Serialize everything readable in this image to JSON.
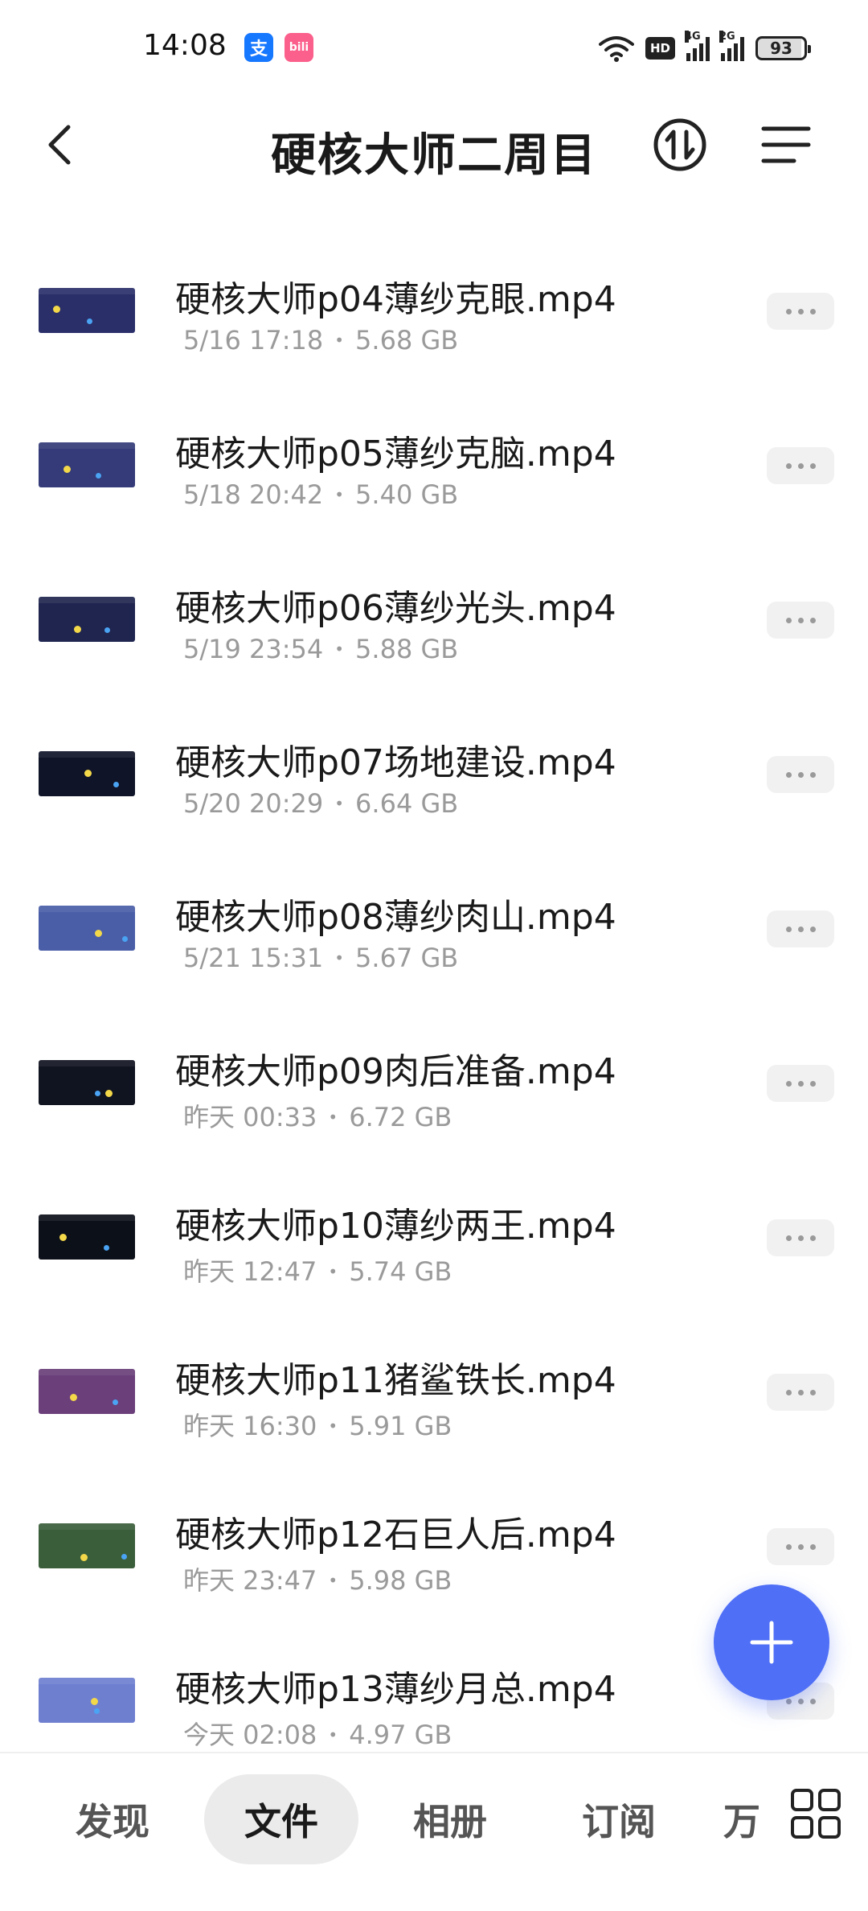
{
  "status_bar": {
    "time": "14:08",
    "app_badge_1": "支",
    "app_badge_2": "bili",
    "hd_label": "HD",
    "signal_1_label": "4G",
    "signal_2_label": "2G",
    "battery_level": "93"
  },
  "header": {
    "title": "硬核大师二周目"
  },
  "files": [
    {
      "name": "硬核大师p04薄纱克眼.mp4",
      "date": "5/16 17:18",
      "size": "5.68 GB",
      "thumb_color": "#2a2f6a"
    },
    {
      "name": "硬核大师p05薄纱克脑.mp4",
      "date": "5/18 20:42",
      "size": "5.40 GB",
      "thumb_color": "#343b78"
    },
    {
      "name": "硬核大师p06薄纱光头.mp4",
      "date": "5/19 23:54",
      "size": "5.88 GB",
      "thumb_color": "#1f254f"
    },
    {
      "name": "硬核大师p07场地建设.mp4",
      "date": "5/20 20:29",
      "size": "6.64 GB",
      "thumb_color": "#0f1428"
    },
    {
      "name": "硬核大师p08薄纱肉山.mp4",
      "date": "5/21 15:31",
      "size": "5.67 GB",
      "thumb_color": "#4a5ea8"
    },
    {
      "name": "硬核大师p09肉后准备.mp4",
      "date": "昨天 00:33",
      "size": "6.72 GB",
      "thumb_color": "#101320"
    },
    {
      "name": "硬核大师p10薄纱两王.mp4",
      "date": "昨天 12:47",
      "size": "5.74 GB",
      "thumb_color": "#0c1018"
    },
    {
      "name": "硬核大师p11猪鲨铁长.mp4",
      "date": "昨天 16:30",
      "size": "5.91 GB",
      "thumb_color": "#6a3f7a"
    },
    {
      "name": "硬核大师p12石巨人后.mp4",
      "date": "昨天 23:47",
      "size": "5.98 GB",
      "thumb_color": "#3a5e3a"
    },
    {
      "name": "硬核大师p13薄纱月总.mp4",
      "date": "今天 02:08",
      "size": "4.97 GB",
      "thumb_color": "#6f7fd0"
    }
  ],
  "bottom_nav": {
    "tabs": [
      {
        "label": "发现"
      },
      {
        "label": "文件"
      },
      {
        "label": "相册"
      },
      {
        "label": "订阅"
      },
      {
        "label": "万"
      }
    ],
    "active_tab": "文件"
  },
  "icons": {
    "back": "chevron-left-icon",
    "sort": "sort-icon",
    "menu": "menu-icon",
    "add": "plus-icon",
    "grid": "grid-icon",
    "more": "more-horizontal-icon"
  },
  "colors": {
    "accent": "#4f6ff6",
    "meta_text": "#9a9a9a",
    "more_button_bg": "#f1f1f1",
    "active_tab_bg": "#ebebeb"
  }
}
